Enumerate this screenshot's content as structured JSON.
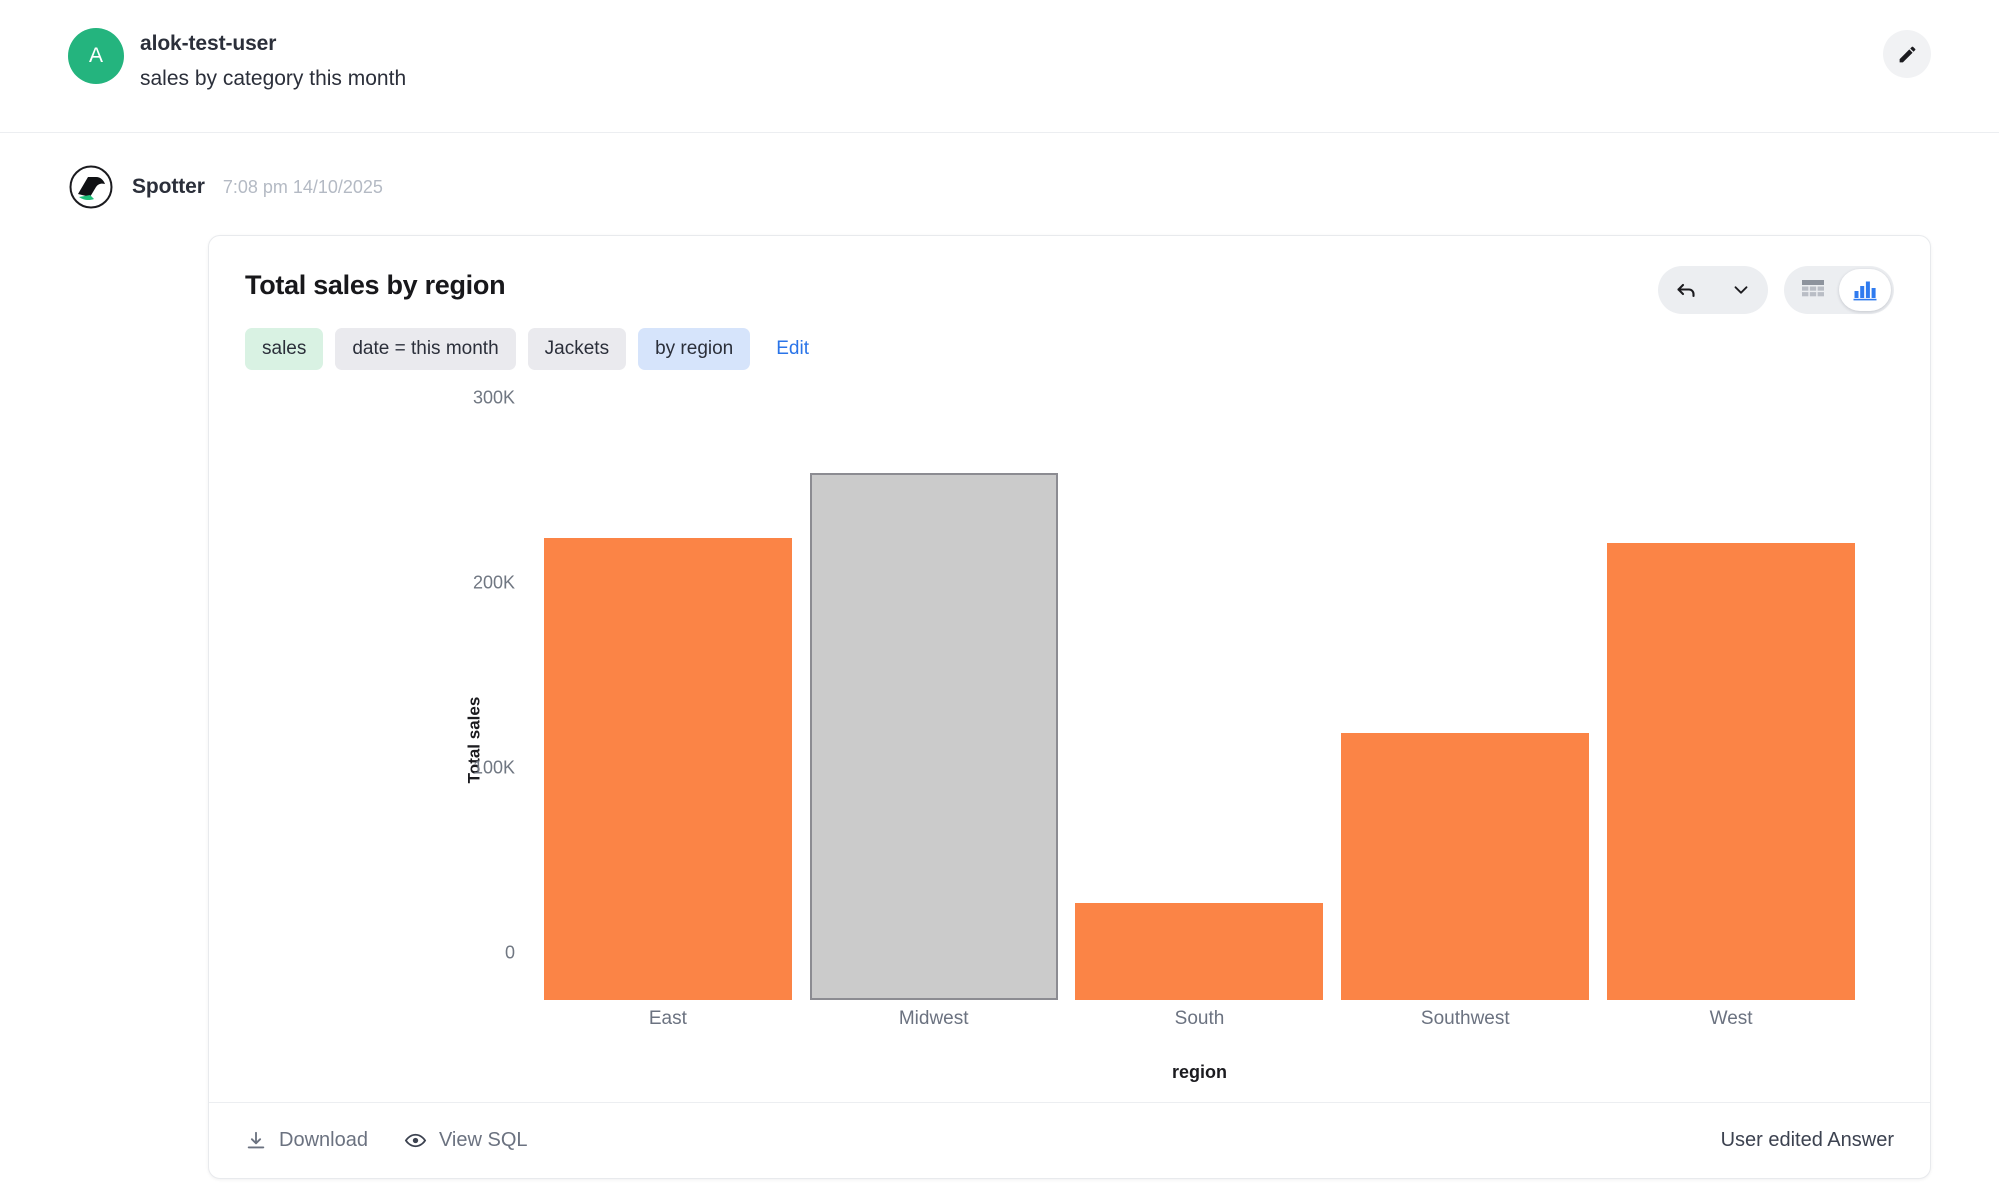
{
  "user": {
    "avatar_initial": "A",
    "name": "alok-test-user",
    "query": "sales by category this month",
    "edit_icon": "pencil-icon"
  },
  "assistant": {
    "name": "Spotter",
    "timestamp": "7:08 pm 14/10/2025",
    "logo_icon": "spotter-logo-icon"
  },
  "card": {
    "title": "Total sales by region",
    "chips": [
      {
        "label": "sales",
        "kind": "measure"
      },
      {
        "label": "date = this month",
        "kind": "filter"
      },
      {
        "label": "Jackets",
        "kind": "filter"
      },
      {
        "label": "by region",
        "kind": "group"
      }
    ],
    "edit_link": "Edit",
    "tools": {
      "undo_icon": "undo-arrow-icon",
      "chevron_icon": "chevron-down-icon",
      "table_view_icon": "table-icon",
      "chart_view_icon": "bar-chart-icon",
      "active_view": "chart"
    },
    "footer": {
      "download_label": "Download",
      "download_icon": "download-icon",
      "view_sql_label": "View SQL",
      "view_sql_icon": "eye-icon",
      "status": "User edited Answer"
    }
  },
  "colors": {
    "bar": "#fb8446",
    "bar_selected": "#cbcbcb",
    "bar_selected_border": "#8c8c92",
    "accent_link": "#2a74e8",
    "avatar_green": "#24b47e",
    "chip_measure": "#d9f2e3",
    "chip_filter": "#eaeaee",
    "chip_group": "#d6e4fb"
  },
  "chart_data": {
    "type": "bar",
    "title": "Total sales by region",
    "xlabel": "region",
    "ylabel": "Total sales",
    "categories": [
      "East",
      "Midwest",
      "South",
      "Southwest",
      "West"
    ],
    "values": [
      250000,
      285000,
      52000,
      144000,
      247000
    ],
    "ylim": [
      0,
      300000
    ],
    "ytick_labels": [
      "300K",
      "200K",
      "100K",
      "0"
    ],
    "ytick_values": [
      300000,
      200000,
      100000,
      0
    ],
    "grid": false,
    "legend": "none",
    "highlighted_category": "Midwest"
  }
}
